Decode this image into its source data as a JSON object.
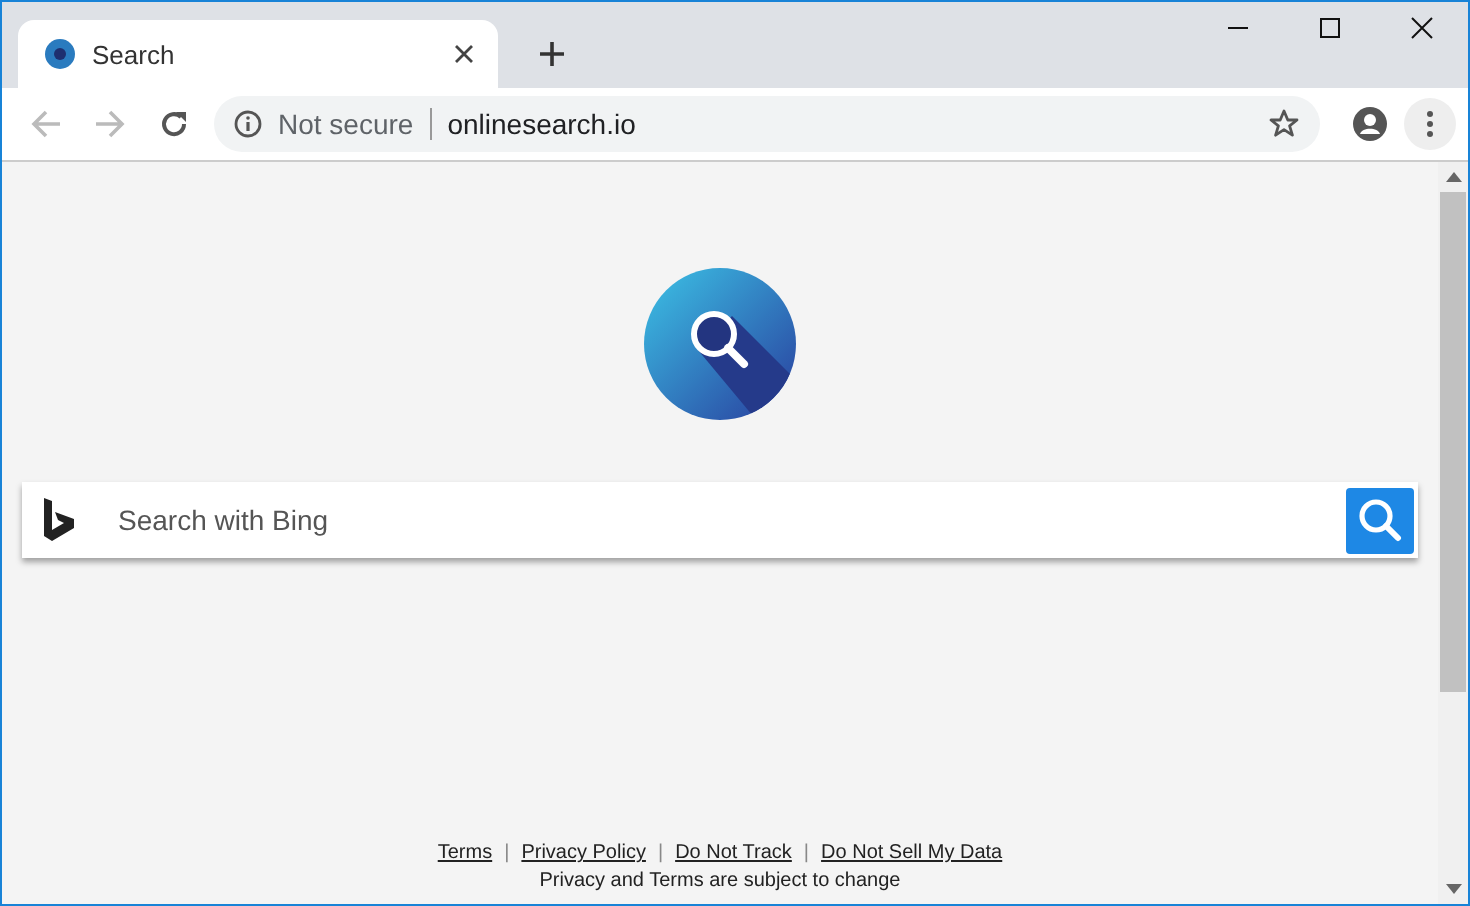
{
  "tab": {
    "title": "Search",
    "selected": true
  },
  "address_bar": {
    "security": "Not secure",
    "url": "onlinesearch.io"
  },
  "search": {
    "placeholder": "Search with Bing"
  },
  "footer": {
    "links": [
      "Terms",
      "Privacy Policy",
      "Do Not Track",
      "Do Not Sell My Data"
    ],
    "separator": "|",
    "note": "Privacy and Terms are subject to change"
  }
}
